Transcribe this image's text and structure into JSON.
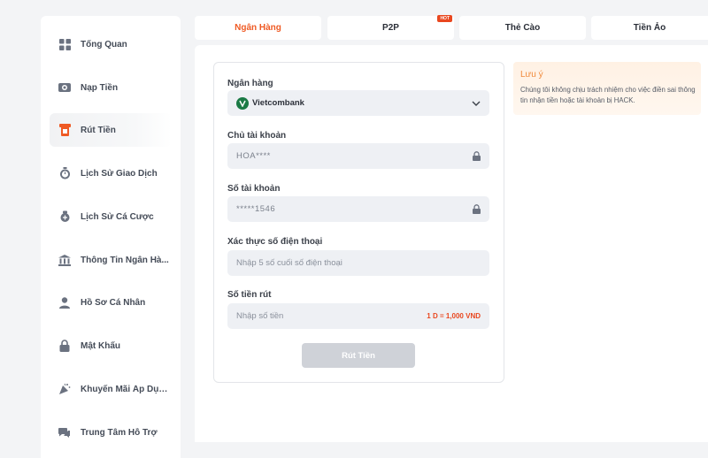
{
  "sidebar": {
    "items": [
      {
        "label": "Tổng Quan",
        "icon": "dashboard-icon",
        "active": false
      },
      {
        "label": "Nạp Tiền",
        "icon": "deposit-icon",
        "active": false
      },
      {
        "label": "Rút Tiền",
        "icon": "withdraw-icon",
        "active": true
      },
      {
        "label": "Lịch Sử Giao Dịch",
        "icon": "transaction-history-icon",
        "active": false
      },
      {
        "label": "Lịch Sử Cá Cược",
        "icon": "bet-history-icon",
        "active": false
      },
      {
        "label": "Thông Tin Ngân Hà...",
        "icon": "bank-icon",
        "active": false
      },
      {
        "label": "Hồ Sơ Cá Nhân",
        "icon": "user-icon",
        "active": false
      },
      {
        "label": "Mật Khẩu",
        "icon": "lock-icon",
        "active": false
      },
      {
        "label": "Khuyến Mãi Áp Dụng",
        "icon": "promotion-icon",
        "active": false
      },
      {
        "label": "Trung Tâm Hỗ Trợ",
        "icon": "support-icon",
        "active": false
      }
    ]
  },
  "tabs": [
    {
      "label": "Ngân Hàng",
      "active": true,
      "badge": ""
    },
    {
      "label": "P2P",
      "active": false,
      "badge": "HOT"
    },
    {
      "label": "Thẻ Cào",
      "active": false,
      "badge": ""
    },
    {
      "label": "Tiền Ảo",
      "active": false,
      "badge": ""
    }
  ],
  "form": {
    "bank_label": "Ngân hàng",
    "bank_value": "Vietcombank",
    "holder_label": "Chủ tài khoản",
    "holder_value": "HOA****",
    "account_label": "Số tài khoản",
    "account_value": "*****1546",
    "phone_label": "Xác thực số điện thoại",
    "phone_placeholder": "Nhập 5 số cuối số điện thoại",
    "amount_label": "Số tiền rút",
    "amount_placeholder": "Nhập số tiền",
    "amount_rate": "1 D = 1,000 VND",
    "submit_label": "Rút Tiền"
  },
  "notice": {
    "title": "Lưu ý",
    "body": "Chúng tôi không chịu trách nhiệm cho việc điền sai thông tin nhận tiền hoặc tài khoản bị HACK."
  },
  "colors": {
    "accent": "#ef5a24",
    "hot_badge": "#e9471f",
    "bank_logo": "#1b7a45",
    "notice_title": "#f08a3c",
    "button_disabled": "#cfd2d8"
  }
}
